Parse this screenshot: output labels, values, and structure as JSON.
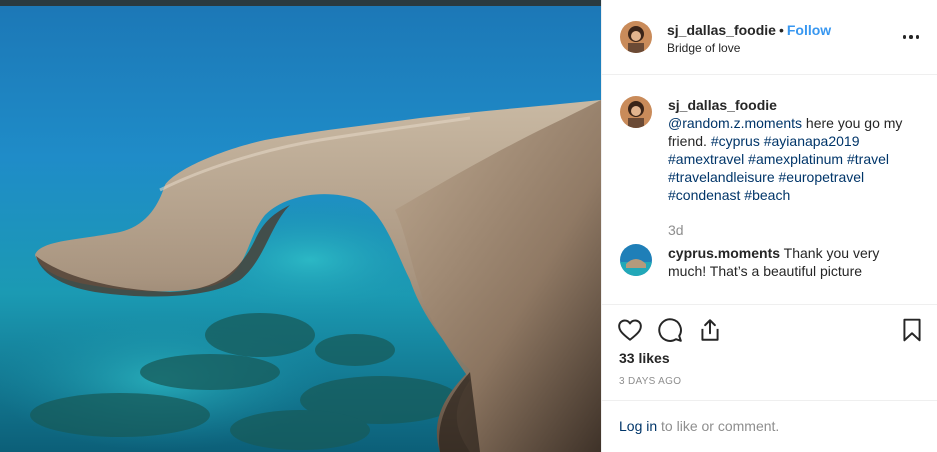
{
  "photo": {
    "alt": "Bridge of love"
  },
  "header": {
    "username": "sj_dallas_foodie",
    "separator": "•",
    "follow_label": "Follow",
    "location": "Bridge of love"
  },
  "caption": {
    "username": "sj_dallas_foodie",
    "mention": "@random.z.moments",
    "text_1": " here you go my friend. ",
    "hashtags": [
      "#cyprus",
      "#ayianapa2019",
      "#amextravel",
      "#amexplatinum",
      "#travel",
      "#travelandleisure",
      "#europetravel",
      "#condenast",
      "#beach"
    ],
    "time": "3d"
  },
  "reply": {
    "username": "cyprus.moments",
    "text": " Thank you very much! That’s a beautiful picture"
  },
  "engagement": {
    "likes": "33 likes",
    "date": "3 DAYS AGO"
  },
  "footer": {
    "login_label": "Log in",
    "rest": " to like or comment."
  },
  "colors": {
    "accent": "#3897f0",
    "link": "#003569",
    "muted": "#8e8e8e",
    "text": "#262626"
  },
  "icons": [
    "heart-icon",
    "comment-icon",
    "share-icon",
    "bookmark-icon",
    "more-options-icon"
  ]
}
